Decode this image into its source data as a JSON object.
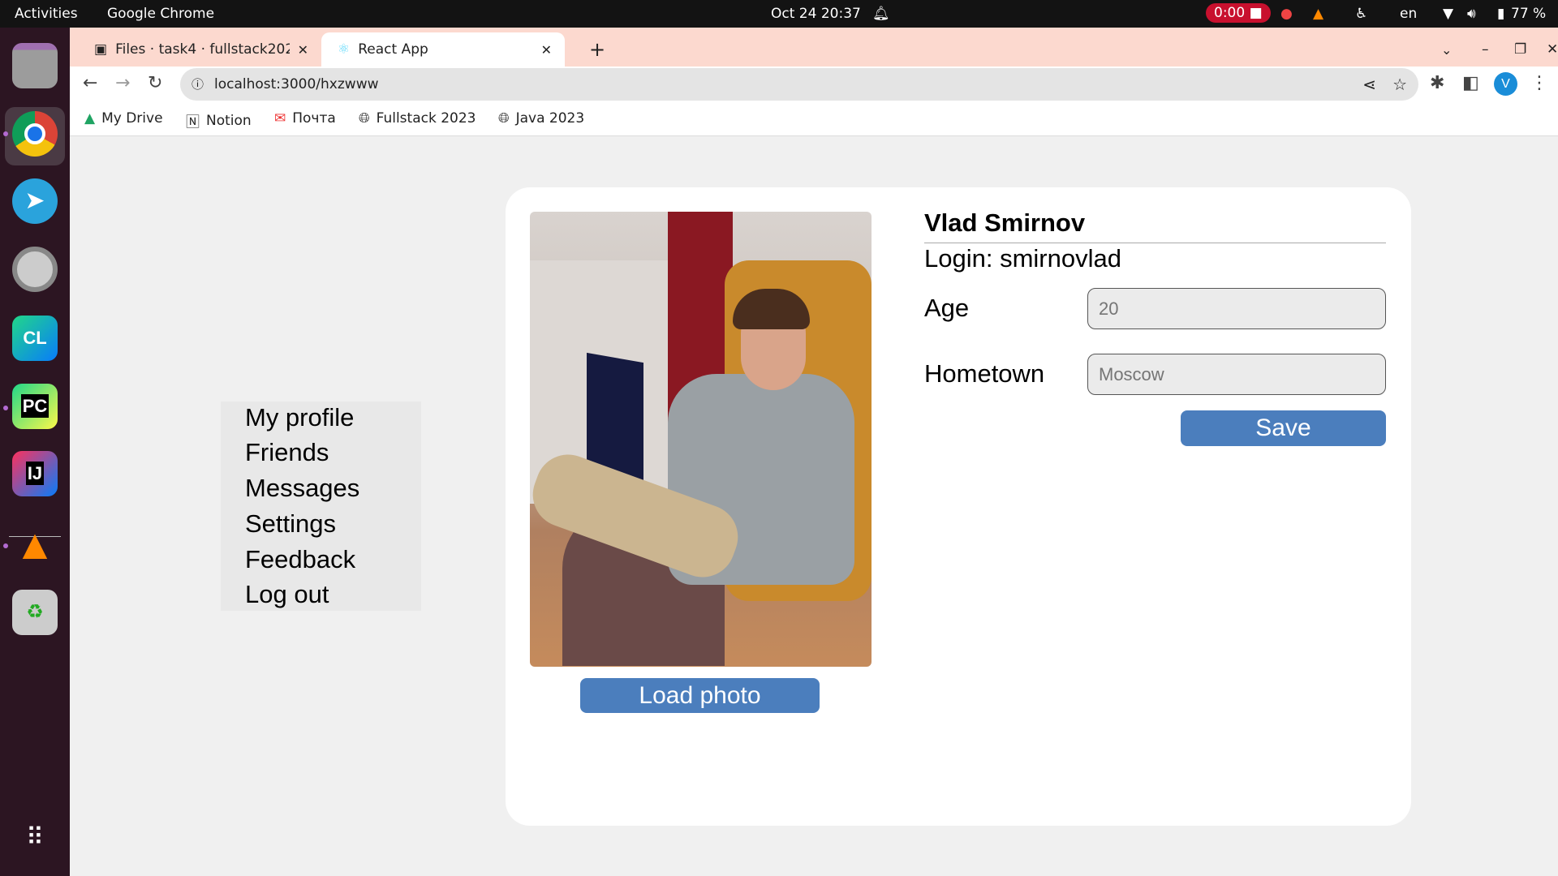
{
  "topbar": {
    "activities": "Activities",
    "app": "Google Chrome",
    "datetime": "Oct 24  20:37",
    "recording": "0:00",
    "lang": "en",
    "battery": "77 %"
  },
  "browser": {
    "tabs": [
      {
        "label": "Files · task4 · fullstack202"
      },
      {
        "label": "React App"
      }
    ],
    "url": "localhost:3000/hxzwww",
    "avatar": "V",
    "bookmarks": [
      {
        "label": "My Drive",
        "icon": "drive-icon"
      },
      {
        "label": "Notion",
        "icon": "notion-icon"
      },
      {
        "label": "Почта",
        "icon": "mail-icon"
      },
      {
        "label": "Fullstack 2023",
        "icon": "globe-icon"
      },
      {
        "label": "Java 2023",
        "icon": "globe-icon"
      }
    ]
  },
  "menu": {
    "items": [
      "My profile",
      "Friends",
      "Messages",
      "Settings",
      "Feedback",
      "Log out"
    ]
  },
  "profile": {
    "name": "Vlad Smirnov",
    "login": "Login: smirnovlad",
    "age_label": "Age",
    "age_placeholder": "20",
    "hometown_label": "Hometown",
    "hometown_placeholder": "Moscow",
    "save": "Save",
    "load_photo": "Load photo"
  },
  "colors": {
    "accent": "#4b7ebd",
    "tabbar": "#fcd9cf",
    "dock": "#2c1522"
  }
}
